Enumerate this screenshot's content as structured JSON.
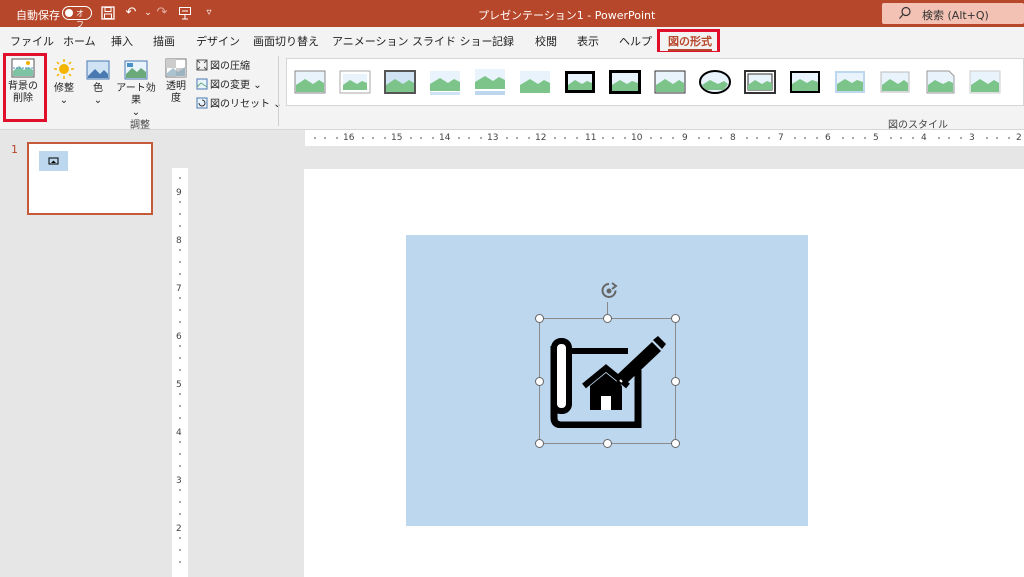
{
  "titlebar": {
    "autosave_label": "自動保存",
    "autosave_state": "オフ",
    "doc_title": "プレゼンテーション1 - PowerPoint",
    "search_placeholder": "検索 (Alt+Q)",
    "accent_color": "#b7472a"
  },
  "tabs": [
    {
      "label": "ファイル"
    },
    {
      "label": "ホーム"
    },
    {
      "label": "挿入"
    },
    {
      "label": "描画"
    },
    {
      "label": "デザイン"
    },
    {
      "label": "画面切り替え"
    },
    {
      "label": "アニメーション"
    },
    {
      "label": "スライド ショー"
    },
    {
      "label": "記録"
    },
    {
      "label": "校閲"
    },
    {
      "label": "表示"
    },
    {
      "label": "ヘルプ"
    },
    {
      "label": "図の形式",
      "active": true
    }
  ],
  "ribbon": {
    "remove_bg": {
      "line1": "背景の",
      "line2": "削除"
    },
    "corrections": "修整",
    "color": "色",
    "art_effects": "アート効果",
    "transparency": {
      "line1": "透明",
      "line2": "度"
    },
    "compress": "図の圧縮",
    "change_picture": "図の変更",
    "reset_picture": "図のリセット",
    "group_adjust": "調整",
    "group_picture_styles": "図のスタイル"
  },
  "slides_pane": {
    "slide_number": "1"
  },
  "hruler_labels": [
    "16",
    "15",
    "14",
    "13",
    "12",
    "11",
    "10",
    "9",
    "8",
    "7",
    "6",
    "5",
    "4",
    "3",
    "2"
  ],
  "vruler_labels": [
    "9",
    "8",
    "7",
    "6",
    "5",
    "4",
    "3",
    "2"
  ],
  "icons": {
    "picture_icon": "landscape-picture",
    "slide_graphic": "house-blueprint-pencil",
    "rotate_handle": "rotate-icon"
  },
  "colors": {
    "slide_box": "#bdd7ee",
    "highlight": "#e0102d"
  }
}
